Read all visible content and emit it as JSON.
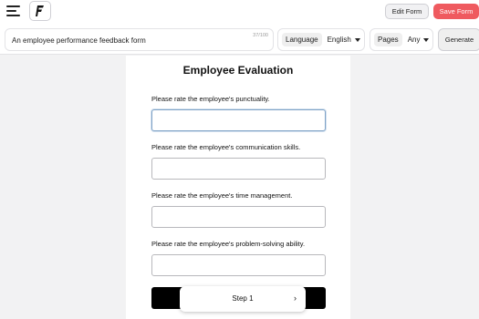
{
  "toolbar": {
    "edit_label": "Edit Form",
    "save_label": "Save Form",
    "save_color": "#ef5a5f",
    "generate_label": "Generate"
  },
  "prompt": {
    "value": "An employee performance feedback form",
    "count": "37/100"
  },
  "language": {
    "label": "Language",
    "value": "English"
  },
  "pages": {
    "label": "Pages",
    "value": "Any"
  },
  "form": {
    "title": "Employee Evaluation",
    "questions": [
      "Please rate the employee's punctuality.",
      "Please rate the employee's communication skills.",
      "Please rate the employee's time management.",
      "Please rate the employee's problem-solving ability."
    ]
  },
  "stepper": {
    "label": "Step 1"
  },
  "icons": {
    "menu": "hamburger-menu-icon",
    "logo": "app-logo-icon",
    "caret": "caret-down-icon",
    "chevron": "chevron-right-icon"
  }
}
